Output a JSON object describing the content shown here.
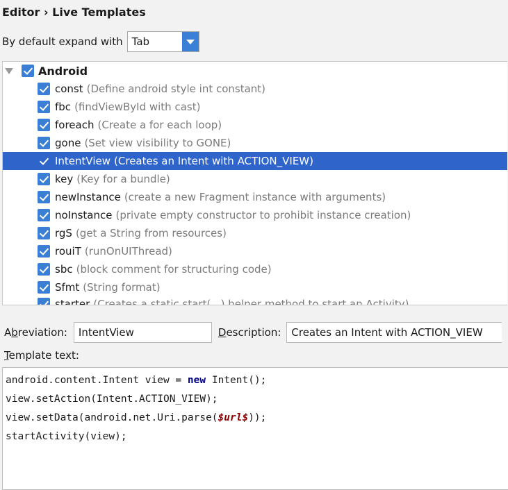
{
  "breadcrumb": "Editor › Live Templates",
  "expand": {
    "label": "By default expand with",
    "selected": "Tab"
  },
  "tree": {
    "group": {
      "name": "Android",
      "checked": true
    },
    "items": [
      {
        "name": "const",
        "desc": "(Define android style int constant)",
        "checked": true
      },
      {
        "name": "fbc",
        "desc": "(findViewById with cast)",
        "checked": true
      },
      {
        "name": "foreach",
        "desc": "(Create a for each loop)",
        "checked": true
      },
      {
        "name": "gone",
        "desc": "(Set view visibility to GONE)",
        "checked": true
      },
      {
        "name": "IntentView",
        "desc": "(Creates an Intent with ACTION_VIEW)",
        "checked": true,
        "selected": true
      },
      {
        "name": "key",
        "desc": "(Key for a bundle)",
        "checked": true
      },
      {
        "name": "newInstance",
        "desc": "(create a new Fragment instance with arguments)",
        "checked": true
      },
      {
        "name": "noInstance",
        "desc": "(private empty constructor to prohibit instance creation)",
        "checked": true
      },
      {
        "name": "rgS",
        "desc": "(get a String from resources)",
        "checked": true
      },
      {
        "name": "rouiT",
        "desc": "(runOnUIThread)",
        "checked": true
      },
      {
        "name": "sbc",
        "desc": "(block comment for structuring code)",
        "checked": true
      },
      {
        "name": "Sfmt",
        "desc": "(String format)",
        "checked": true
      },
      {
        "name": "starter",
        "desc": "(Creates a static start(...) helper method to start an Activity)",
        "checked": true,
        "partial": true
      }
    ]
  },
  "abbreviation": {
    "label_mnemonic": "b",
    "label_rest": "reviation:",
    "label_prefix": "A",
    "value": "IntentView"
  },
  "description": {
    "label_mnemonic": "D",
    "label_rest": "escription:",
    "value": "Creates an Intent with ACTION_VIEW"
  },
  "template_text": {
    "label_mnemonic": "T",
    "label_rest": "emplate text:",
    "lines": [
      [
        {
          "t": "android.content.Intent view = "
        },
        {
          "t": "new",
          "c": "kw"
        },
        {
          "t": " Intent();"
        }
      ],
      [
        {
          "t": "view.setAction(Intent.ACTION_VIEW);"
        }
      ],
      [
        {
          "t": "view.setData(android.net.Uri.parse("
        },
        {
          "t": "$url$",
          "c": "var"
        },
        {
          "t": "));"
        }
      ],
      [
        {
          "t": "startActivity(view);"
        }
      ]
    ]
  },
  "colors": {
    "accent": "#3a7fd5",
    "selection": "#2f65ca",
    "keyword": "#000080",
    "variable": "#8b0000"
  }
}
